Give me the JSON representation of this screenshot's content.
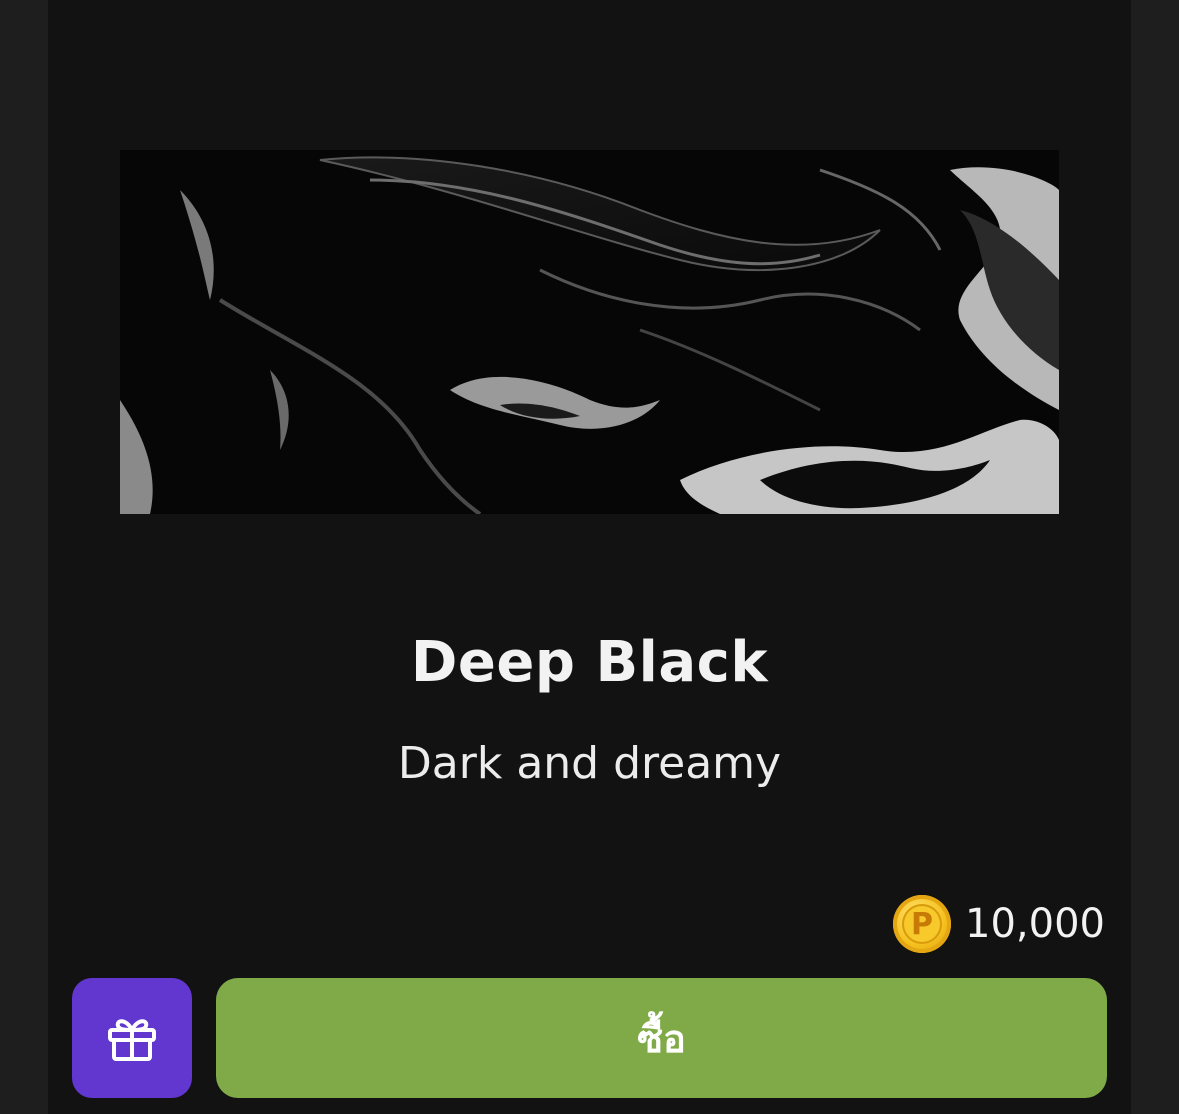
{
  "item": {
    "title": "Deep Black",
    "subtitle": "Dark and dreamy",
    "price": "10,000",
    "currency_icon": "coin-p-icon",
    "currency_symbol": "P"
  },
  "actions": {
    "gift_icon": "gift-icon",
    "buy_label": "ซื้อ"
  },
  "colors": {
    "page_background": "#1e1e1e",
    "card_background": "#121212",
    "gift_button": "#6237cf",
    "buy_button": "#80aa47",
    "coin": "#f6c21f"
  }
}
